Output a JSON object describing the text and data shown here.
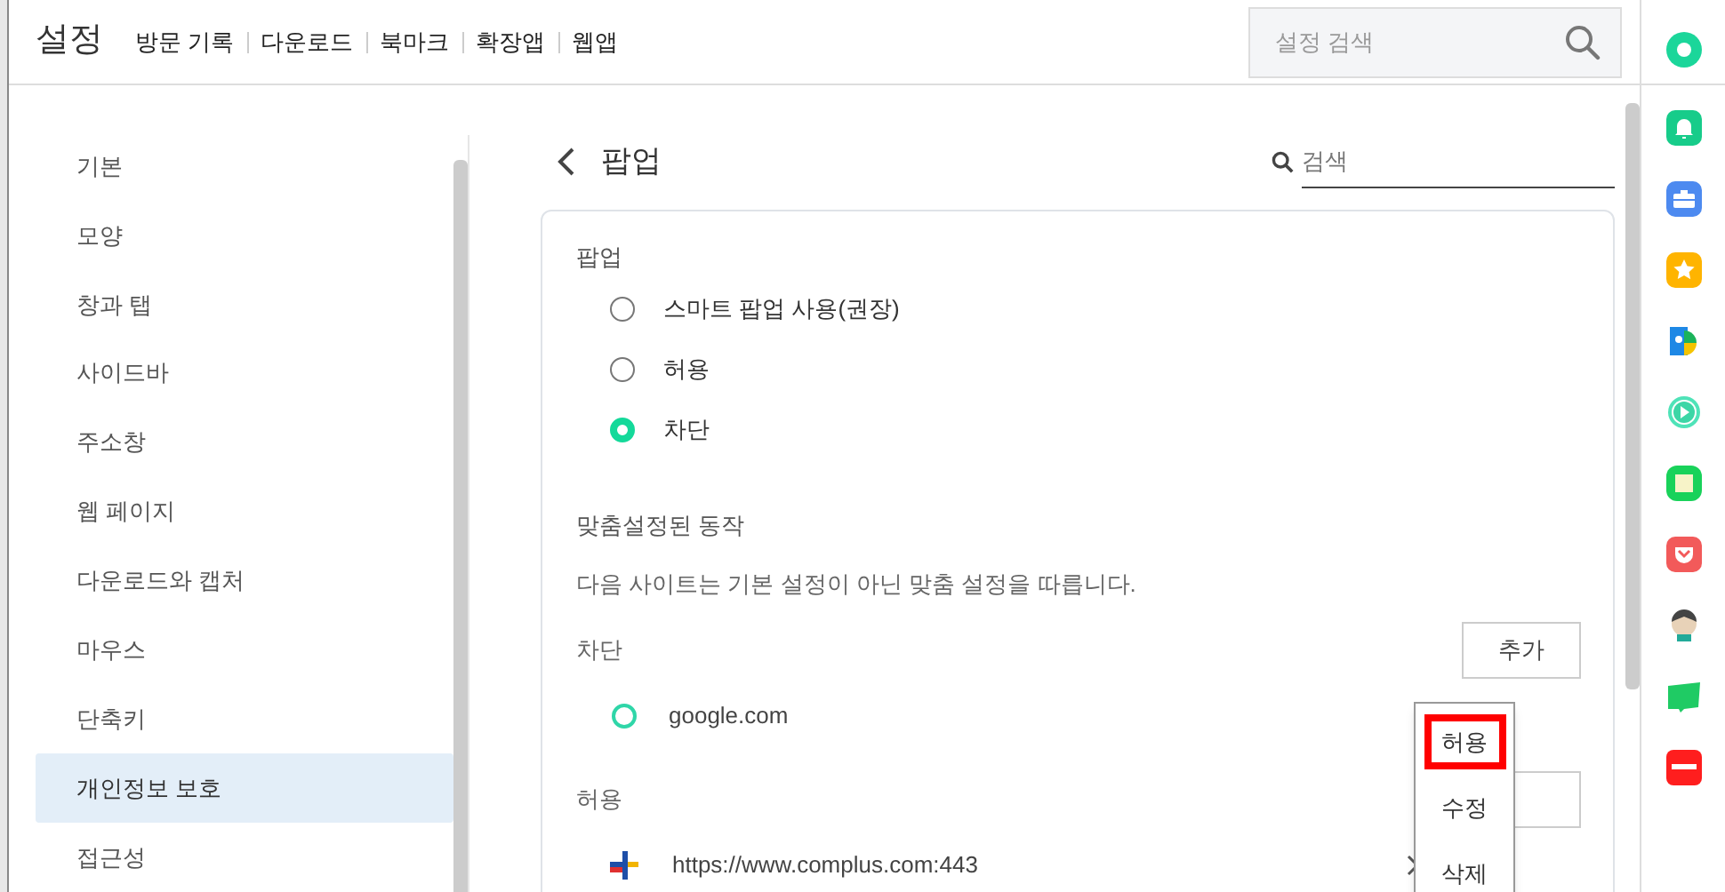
{
  "header": {
    "title": "설정",
    "links": [
      "방문 기록",
      "다운로드",
      "북마크",
      "확장앱",
      "웹앱"
    ],
    "search": {
      "placeholder": "설정 검색"
    }
  },
  "nav": {
    "items": [
      {
        "label": "기본",
        "selected": false
      },
      {
        "label": "모양",
        "selected": false
      },
      {
        "label": "창과 탭",
        "selected": false
      },
      {
        "label": "사이드바",
        "selected": false
      },
      {
        "label": "주소창",
        "selected": false
      },
      {
        "label": "웹 페이지",
        "selected": false
      },
      {
        "label": "다운로드와 캡처",
        "selected": false
      },
      {
        "label": "마우스",
        "selected": false
      },
      {
        "label": "단축키",
        "selected": false
      },
      {
        "label": "개인정보 보호",
        "selected": true
      },
      {
        "label": "접근성",
        "selected": false
      }
    ]
  },
  "page": {
    "title": "팝업",
    "search": {
      "placeholder": "검색"
    },
    "popup_section": {
      "heading": "팝업",
      "options": [
        {
          "label": "스마트 팝업 사용(권장)",
          "selected": false
        },
        {
          "label": "허용",
          "selected": false
        },
        {
          "label": "차단",
          "selected": true
        }
      ]
    },
    "custom_section": {
      "heading": "맞춤설정된 동작",
      "description": "다음 사이트는 기본 설정이 아닌 맞춤 설정을 따릅니다.",
      "blocked": {
        "heading": "차단",
        "add_button": "추가",
        "sites": [
          {
            "name": "google.com"
          }
        ]
      },
      "allowed": {
        "heading": "허용",
        "sites": [
          {
            "name": "https://www.complus.com:443"
          }
        ]
      }
    },
    "context_menu": {
      "items": [
        {
          "label": "허용",
          "highlighted": true
        },
        {
          "label": "수정",
          "highlighted": false
        },
        {
          "label": "삭제",
          "highlighted": false
        }
      ]
    }
  }
}
